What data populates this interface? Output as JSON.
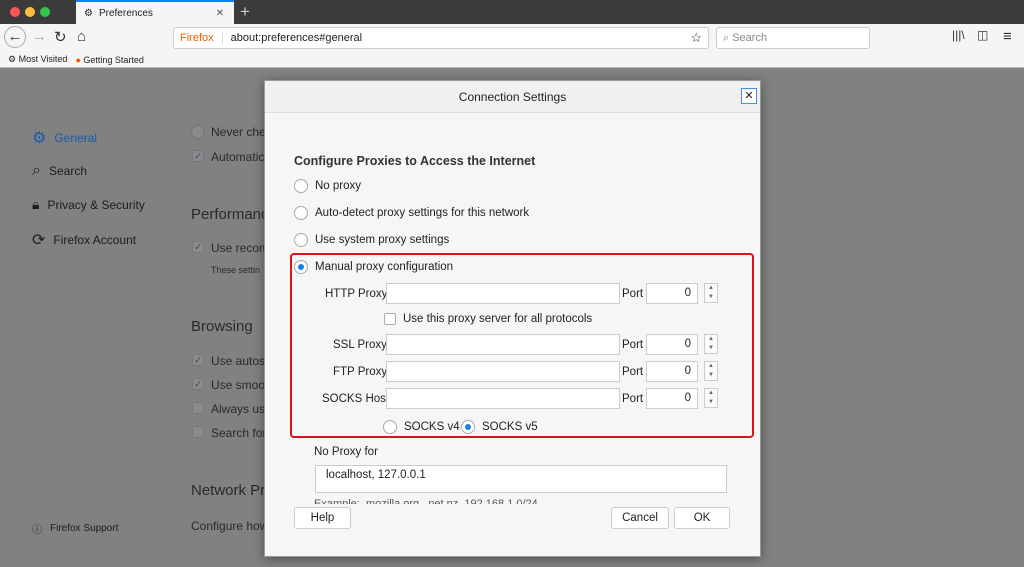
{
  "browser": {
    "tab_title": "Preferences",
    "brand": "Firefox",
    "url": "about:preferences#general",
    "search_placeholder": "Search",
    "bookmarks": [
      "Most Visited",
      "Getting Started"
    ]
  },
  "sidebar": {
    "items": [
      {
        "label": "General",
        "active": true
      },
      {
        "label": "Search"
      },
      {
        "label": "Privacy & Security"
      },
      {
        "label": "Firefox Account"
      }
    ],
    "support": "Firefox Support"
  },
  "background": {
    "never_check": "Never chec",
    "automatically": "Automatica",
    "performance": "Performanc",
    "use_recommended": "Use recom",
    "these_settings": "These settin",
    "browsing": "Browsing",
    "use_autoscroll": "Use autosc",
    "use_smooth": "Use smoot",
    "always_use": "Always use",
    "search_for": "Search for",
    "network": "Network Pr",
    "configure": "Configure how"
  },
  "dialog": {
    "title": "Connection Settings",
    "close": "✕",
    "heading": "Configure Proxies to Access the Internet",
    "options": [
      "No proxy",
      "Auto-detect proxy settings for this network",
      "Use system proxy settings",
      "Manual proxy configuration"
    ],
    "selected_option": "Manual proxy configuration",
    "http_label": "HTTP Proxy",
    "http_value": "",
    "port_label": "Port",
    "http_port": "0",
    "use_all": "Use this proxy server for all protocols",
    "ssl_label": "SSL Proxy",
    "ssl_port": "0",
    "ftp_label": "FTP Proxy",
    "ftp_port": "0",
    "socks_label": "SOCKS Host",
    "socks_port": "0",
    "socks_v4": "SOCKS v4",
    "socks_v5": "SOCKS v5",
    "socks_selected": "SOCKS v5",
    "no_proxy_label": "No Proxy for",
    "no_proxy_value": "localhost, 127.0.0.1",
    "example": "Example: .mozilla.org, .net.nz, 192.168.1.0/24",
    "help": "Help",
    "cancel": "Cancel",
    "ok": "OK"
  },
  "colors": {
    "highlight": "#e0101a",
    "accent": "#0a84ff"
  }
}
